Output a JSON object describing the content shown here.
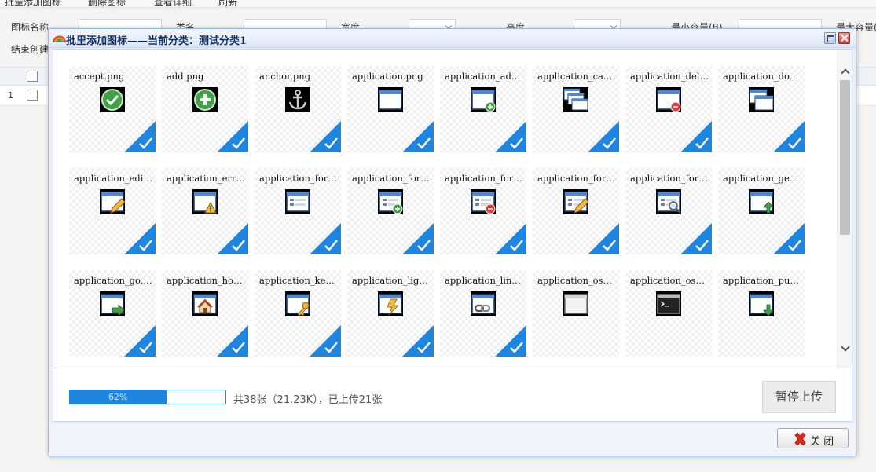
{
  "background": {
    "toolbar": [
      "批量添加图标",
      "删除图标",
      "查看详细",
      "刷新"
    ],
    "form_labels": [
      "图标名称",
      "类名",
      "宽度",
      "高度",
      "最小容量(B)",
      "最大容量(",
      "结束创建"
    ],
    "grid_row_number": "1"
  },
  "dialog": {
    "title": "批里添加图标——当前分类：测试分类1",
    "close_label": "关 闭",
    "pause_label": "暂停上传",
    "progress": {
      "percent": 62,
      "label": "62%"
    },
    "upload_status": "共38张（21.23K），已上传21张"
  },
  "icons": [
    {
      "name": "accept.png",
      "icon": "accept-icon",
      "checked": true
    },
    {
      "name": "add.png",
      "icon": "add-icon",
      "checked": true
    },
    {
      "name": "anchor.png",
      "icon": "anchor-icon",
      "checked": true
    },
    {
      "name": "application.png",
      "icon": "application-icon",
      "checked": true
    },
    {
      "name": "application_add.png",
      "icon": "application-add-icon",
      "checked": true
    },
    {
      "name": "application_cascade.png",
      "icon": "application-cascade-icon",
      "checked": true
    },
    {
      "name": "application_delete.png",
      "icon": "application-delete-icon",
      "checked": true
    },
    {
      "name": "application_double.png",
      "icon": "application-double-icon",
      "checked": true
    },
    {
      "name": "application_edit.png",
      "icon": "application-edit-icon",
      "checked": true
    },
    {
      "name": "application_error.png",
      "icon": "application-error-icon",
      "checked": true
    },
    {
      "name": "application_form.png",
      "icon": "application-form-icon",
      "checked": true
    },
    {
      "name": "application_form_add.png",
      "icon": "application-form-add-icon",
      "checked": true
    },
    {
      "name": "application_form_delete.png",
      "icon": "application-form-delete-icon",
      "checked": true
    },
    {
      "name": "application_form_edit.png",
      "icon": "application-form-edit-icon",
      "checked": true
    },
    {
      "name": "application_form_magnify.png",
      "icon": "application-form-magnify-icon",
      "checked": true
    },
    {
      "name": "application_get.png",
      "icon": "application-get-icon",
      "checked": true
    },
    {
      "name": "application_go.png",
      "icon": "application-go-icon",
      "checked": true
    },
    {
      "name": "application_home.png",
      "icon": "application-home-icon",
      "checked": true
    },
    {
      "name": "application_key.png",
      "icon": "application-key-icon",
      "checked": true
    },
    {
      "name": "application_lightning.png",
      "icon": "application-lightning-icon",
      "checked": true
    },
    {
      "name": "application_link.png",
      "icon": "application-link-icon",
      "checked": true
    },
    {
      "name": "application_osx.png",
      "icon": "application-osx-icon",
      "checked": false
    },
    {
      "name": "application_osx_terminal.png",
      "icon": "application-osx-terminal-icon",
      "checked": false
    },
    {
      "name": "application_put.png",
      "icon": "application-put-icon",
      "checked": false
    }
  ]
}
